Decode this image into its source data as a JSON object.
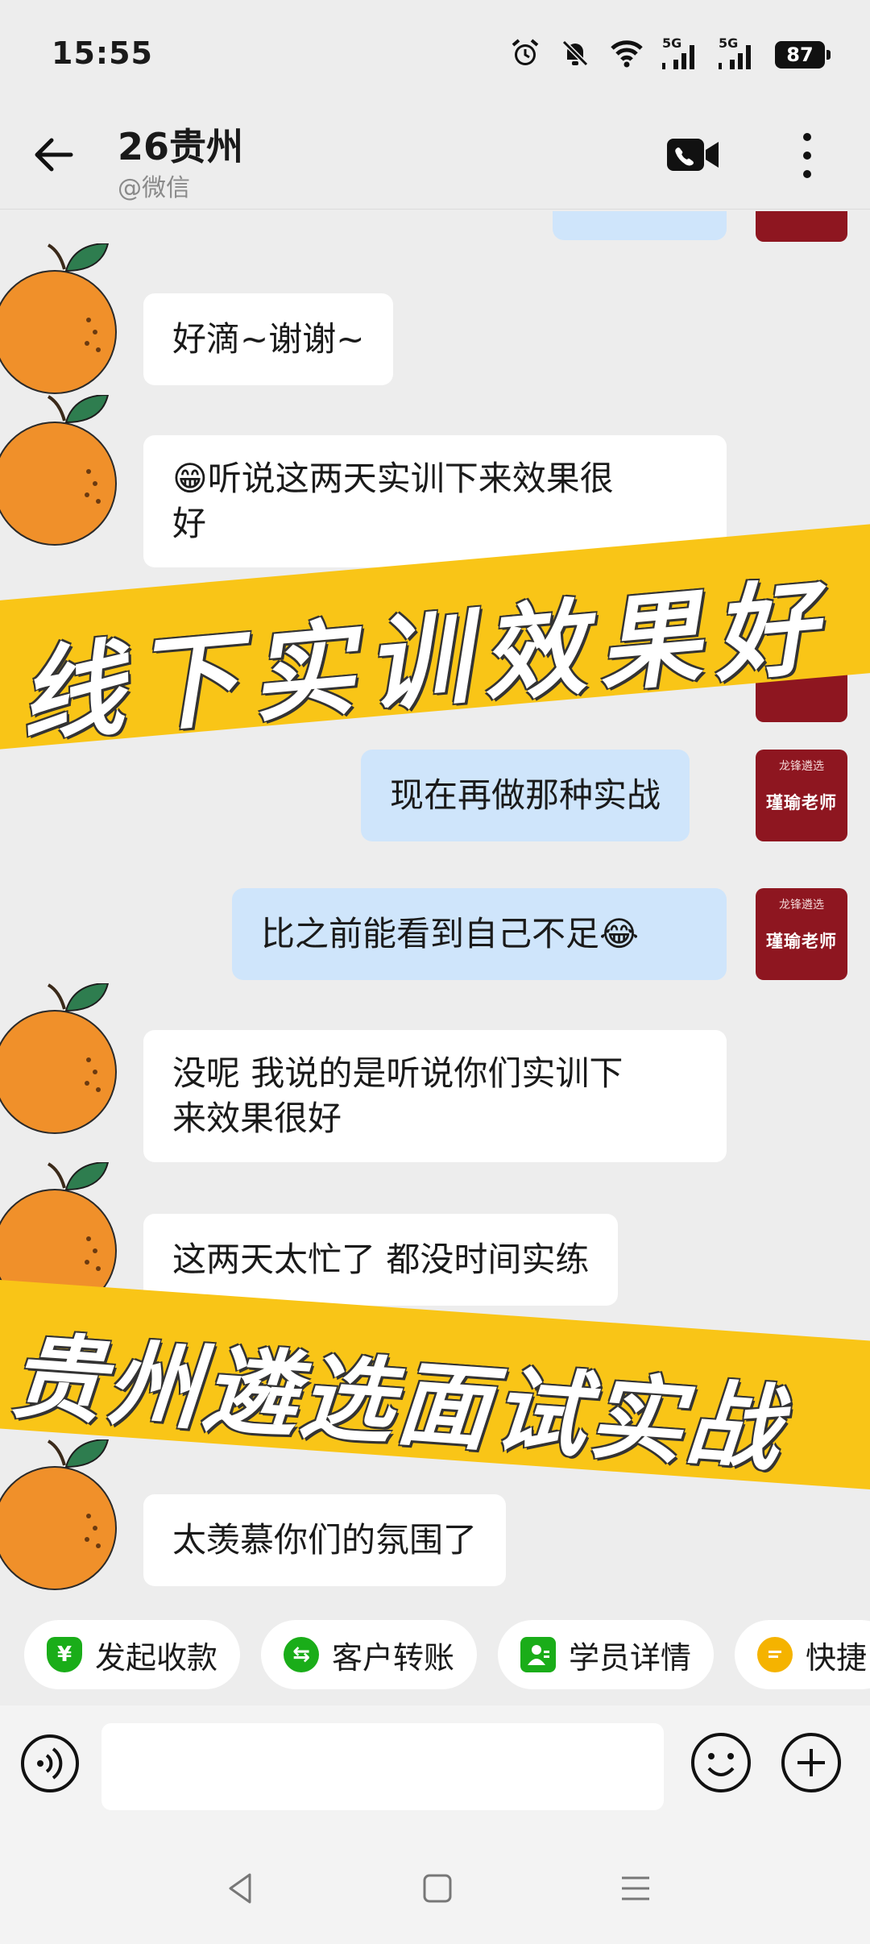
{
  "status": {
    "time": "15:55",
    "battery": "87",
    "network_1": "5G",
    "network_2": "5G",
    "icons": [
      "alarm-icon",
      "bell-muted-icon",
      "wifi-icon",
      "signal-icon",
      "signal-icon",
      "battery-icon"
    ]
  },
  "header": {
    "title": "26贵州",
    "subtitle": "@微信",
    "icons": [
      "back-arrow-icon",
      "video-call-icon",
      "more-vertical-icon"
    ]
  },
  "teacher_avatar": {
    "logo_text": "龙锋遴选",
    "name": "瑾瑜老师"
  },
  "messages": [
    {
      "from": "contact",
      "text": "好滴~谢谢~"
    },
    {
      "from": "contact",
      "text_lines": [
        "😁听说这两天实训下来效果很",
        "好"
      ]
    },
    {
      "from": "teacher",
      "text": "现在再做那种实战"
    },
    {
      "from": "teacher",
      "text": "比之前能看到自己不足😂"
    },
    {
      "from": "contact",
      "text_lines": [
        "没呢 我说的是听说你们实训下",
        "来效果很好"
      ]
    },
    {
      "from": "contact",
      "text": "这两天太忙了 都没时间实练"
    },
    {
      "from": "contact",
      "text": "太羡慕你们的氛围了"
    }
  ],
  "banners": {
    "top": "线下实训效果好",
    "bottom": "贵州遴选面试实战",
    "color": "#F9C517"
  },
  "quick_actions": [
    {
      "label": "发起收款",
      "icon": "yuan-shield-icon",
      "color": "#1AAD19"
    },
    {
      "label": "客户转账",
      "icon": "transfer-icon",
      "color": "#1AAD19"
    },
    {
      "label": "学员详情",
      "icon": "person-card-icon",
      "color": "#1AAD19"
    },
    {
      "label": "快捷",
      "icon": "quick-reply-icon",
      "color": "#F5B300"
    }
  ],
  "input": {
    "placeholder": "",
    "icons": [
      "voice-icon",
      "emoji-icon",
      "plus-icon"
    ]
  },
  "nav": {
    "icons": [
      "nav-back-icon",
      "nav-home-icon",
      "nav-menu-icon"
    ]
  }
}
